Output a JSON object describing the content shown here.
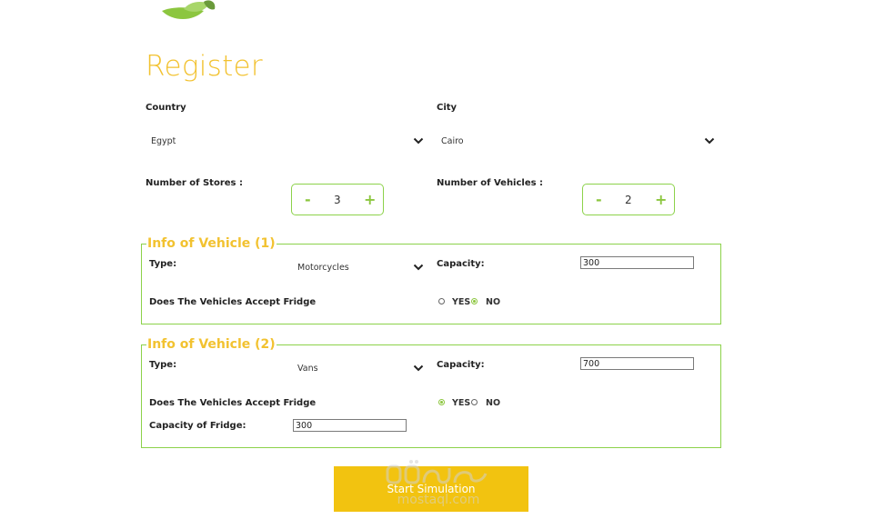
{
  "header": {
    "title": "Register"
  },
  "location": {
    "country_label": "Country",
    "country_value": "Egypt",
    "city_label": "City",
    "city_value": "Cairo"
  },
  "counts": {
    "stores_label": "Number of Stores :",
    "stores_value": "3",
    "vehicles_label": "Number of Vehicles :",
    "vehicles_value": "2",
    "minus_symbol": "-",
    "plus_symbol": "+"
  },
  "vehicles": [
    {
      "legend": "Info of Vehicle (1)",
      "type_label": "Type:",
      "type_value": "Motorcycles",
      "capacity_label": "Capacity:",
      "capacity_value": "300",
      "fridge_question": "Does The Vehicles Accept Fridge",
      "yes_label": "YES",
      "no_label": "NO",
      "fridge_selected": "NO"
    },
    {
      "legend": "Info of Vehicle (2)",
      "type_label": "Type:",
      "type_value": "Vans",
      "capacity_label": "Capacity:",
      "capacity_value": "700",
      "fridge_question": "Does The Vehicles Accept Fridge",
      "yes_label": "YES",
      "no_label": "NO",
      "fridge_selected": "YES",
      "fridge_capacity_label": "Capacity of Fridge:",
      "fridge_capacity_value": "300"
    }
  ],
  "actions": {
    "start_label": "Start Simulation"
  },
  "watermark": {
    "text": "mostaql.com"
  },
  "colors": {
    "accent_yellow": "#f2c230",
    "button_yellow": "#f2c310",
    "border_green": "#8cd24a",
    "icon_green": "#8cc63f"
  },
  "icons": {
    "logo": "leaf-logo-icon",
    "dropdown": "chevron-down-icon",
    "watermark": "mostaql-watermark-logo"
  }
}
